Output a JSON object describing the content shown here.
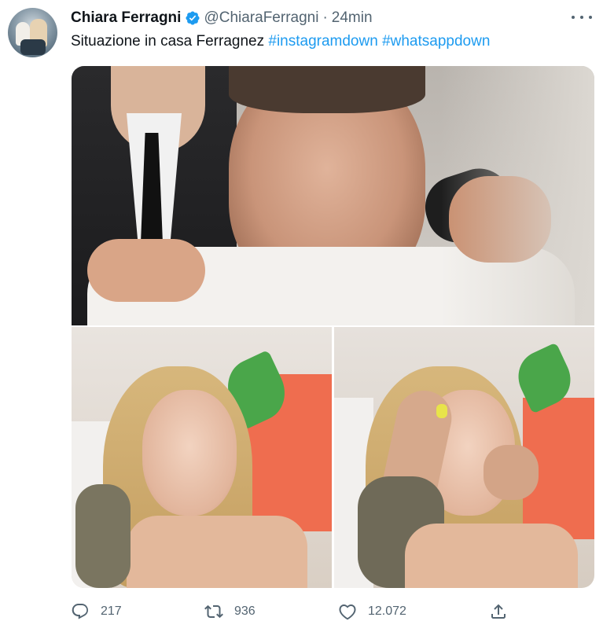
{
  "tweet": {
    "author_name": "Chiara Ferragni",
    "handle": "@ChiaraFerragni",
    "separator": "·",
    "time": "24min",
    "text_prefix": "Situazione in casa Ferragnez",
    "hashtags": [
      "#instagramdown",
      "#whatsappdown"
    ]
  },
  "media": {
    "images": [
      {
        "subject": "man-crying"
      },
      {
        "subject": "woman-crying"
      },
      {
        "subject": "woman-crying-hand-on-head"
      }
    ]
  },
  "actions": {
    "reply_count": "217",
    "retweet_count": "936",
    "like_count": "12.072"
  },
  "icons": {
    "verified": "verified-badge-icon",
    "more": "more-options-icon",
    "reply": "reply-icon",
    "retweet": "retweet-icon",
    "like": "heart-icon",
    "share": "share-icon"
  },
  "colors": {
    "accent": "#1d9bf0",
    "secondary_text": "#536471",
    "primary_text": "#0f1419"
  }
}
